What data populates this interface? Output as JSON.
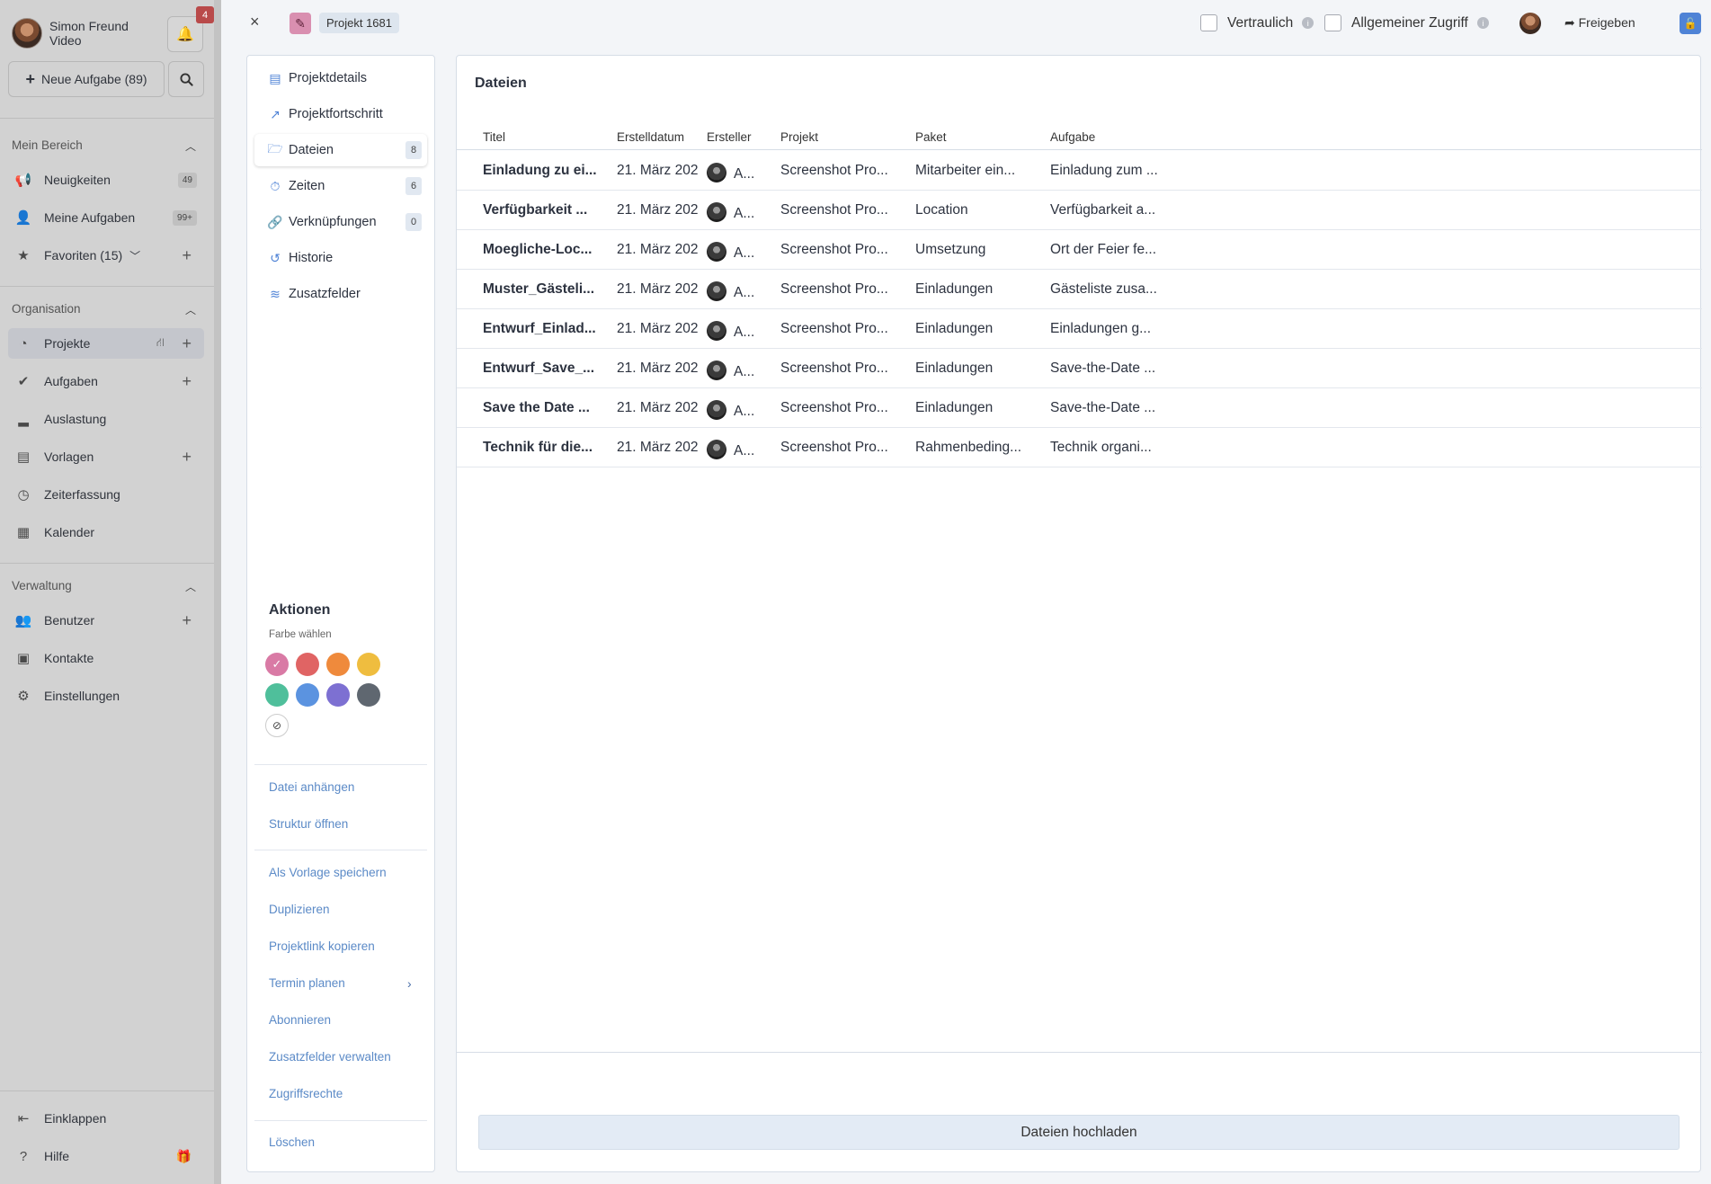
{
  "sidebar": {
    "user_name": "Simon Freund",
    "user_role": "Video",
    "notif_count": "4",
    "new_task_label": "Neue Aufgabe (89)",
    "sections": {
      "mein_bereich": "Mein Bereich",
      "organisation": "Organisation",
      "verwaltung": "Verwaltung"
    },
    "mein_bereich_items": [
      {
        "label": "Neuigkeiten",
        "count": "49"
      },
      {
        "label": "Meine Aufgaben",
        "count": "99+"
      },
      {
        "label": "Favoriten (15)"
      }
    ],
    "organisation_items": [
      {
        "label": "Projekte"
      },
      {
        "label": "Aufgaben"
      },
      {
        "label": "Auslastung"
      },
      {
        "label": "Vorlagen"
      },
      {
        "label": "Zeiterfassung"
      },
      {
        "label": "Kalender"
      }
    ],
    "verwaltung_items": [
      {
        "label": "Benutzer"
      },
      {
        "label": "Kontakte"
      },
      {
        "label": "Einstellungen"
      }
    ],
    "bottom_items": [
      {
        "label": "Einklappen"
      },
      {
        "label": "Hilfe"
      }
    ]
  },
  "topbar": {
    "close_label": "×",
    "project_chip": "Projekt 1681",
    "vertraulich": "Vertraulich",
    "allgemeiner_zugriff": "Allgemeiner Zugriff",
    "share_label": "Freigeben"
  },
  "panel": {
    "nav": [
      {
        "label": "Projektdetails"
      },
      {
        "label": "Projektfortschritt"
      },
      {
        "label": "Dateien",
        "count": "8"
      },
      {
        "label": "Zeiten",
        "count": "6"
      },
      {
        "label": "Verknüpfungen",
        "count": "0"
      },
      {
        "label": "Historie"
      },
      {
        "label": "Zusatzfelder"
      }
    ],
    "actions_title": "Aktionen",
    "color_label": "Farbe wählen",
    "colors": [
      "#d97aa5",
      "#e06464",
      "#ef8a3c",
      "#efbd3f",
      "#4fbf9b",
      "#5b93e0",
      "#7d70d2",
      "#5f6770"
    ],
    "links_1": [
      "Datei anhängen",
      "Struktur öffnen"
    ],
    "links_2": [
      "Als Vorlage speichern",
      "Duplizieren",
      "Projektlink kopieren",
      "Termin planen",
      "Abonnieren",
      "Zusatzfelder verwalten",
      "Zugriffsrechte"
    ],
    "links_3": [
      "Löschen"
    ]
  },
  "files": {
    "title": "Dateien",
    "columns": {
      "titel": "Titel",
      "erstelldatum": "Erstelldatum",
      "ersteller": "Ersteller",
      "projekt": "Projekt",
      "paket": "Paket",
      "aufgabe": "Aufgabe"
    },
    "rows": [
      {
        "titel": "Einladung zu ei...",
        "datum": "21. März 202",
        "ersteller": "A...",
        "projekt": "Screenshot Pro...",
        "paket": "Mitarbeiter ein...",
        "aufgabe": "Einladung zum ..."
      },
      {
        "titel": "Verfügbarkeit ...",
        "datum": "21. März 202",
        "ersteller": "A...",
        "projekt": "Screenshot Pro...",
        "paket": "Location",
        "aufgabe": "Verfügbarkeit a..."
      },
      {
        "titel": "Moegliche-Loc...",
        "datum": "21. März 202",
        "ersteller": "A...",
        "projekt": "Screenshot Pro...",
        "paket": "Umsetzung",
        "aufgabe": "Ort der Feier fe..."
      },
      {
        "titel": "Muster_Gästeli...",
        "datum": "21. März 202",
        "ersteller": "A...",
        "projekt": "Screenshot Pro...",
        "paket": "Einladungen",
        "aufgabe": "Gästeliste zusa..."
      },
      {
        "titel": "Entwurf_Einlad...",
        "datum": "21. März 202",
        "ersteller": "A...",
        "projekt": "Screenshot Pro...",
        "paket": "Einladungen",
        "aufgabe": "Einladungen g..."
      },
      {
        "titel": "Entwurf_Save_...",
        "datum": "21. März 202",
        "ersteller": "A...",
        "projekt": "Screenshot Pro...",
        "paket": "Einladungen",
        "aufgabe": "Save-the-Date ..."
      },
      {
        "titel": "Save the Date ...",
        "datum": "21. März 202",
        "ersteller": "A...",
        "projekt": "Screenshot Pro...",
        "paket": "Einladungen",
        "aufgabe": "Save-the-Date ..."
      },
      {
        "titel": "Technik für die...",
        "datum": "21. März 202",
        "ersteller": "A...",
        "projekt": "Screenshot Pro...",
        "paket": "Rahmenbeding...",
        "aufgabe": "Technik organi..."
      }
    ],
    "upload_label": "Dateien hochladen"
  }
}
